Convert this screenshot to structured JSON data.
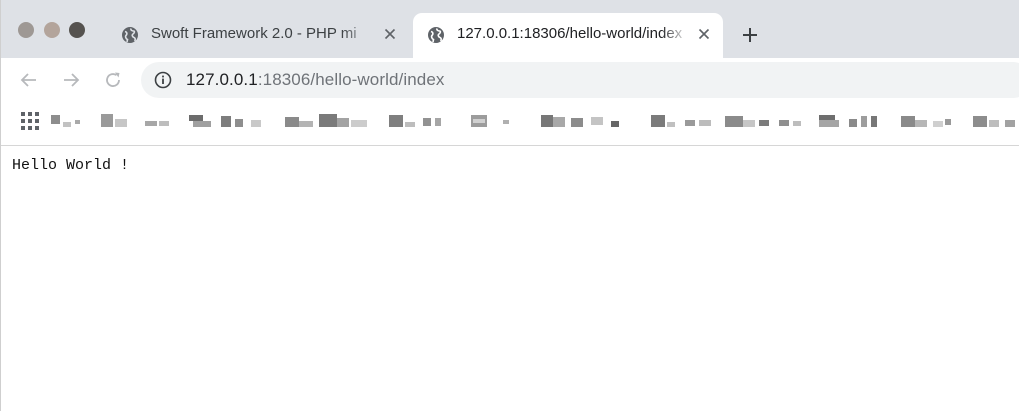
{
  "browser": {
    "tabs": [
      {
        "title": "Swoft Framework 2.0 - PHP mi",
        "favicon": "globe-icon",
        "active": false
      },
      {
        "title": "127.0.0.1:18306/hello-world/index",
        "favicon": "globe-icon",
        "active": true
      }
    ],
    "new_tab_icon": "plus-icon",
    "nav": {
      "back_icon": "arrow-left-icon",
      "forward_icon": "arrow-right-icon",
      "reload_icon": "reload-icon"
    },
    "address_bar": {
      "info_icon": "info-icon",
      "host": "127.0.0.1",
      "rest": ":18306/hello-world/index"
    },
    "bookmarks_bar": {
      "apps_icon": "apps-grid-icon",
      "items_blurred": true
    },
    "colors": {
      "tabstrip": "#dee1e6",
      "omnibox": "#f1f3f4",
      "url_host": "#202124",
      "url_rest": "#6f7378"
    }
  },
  "page": {
    "body_text": "Hello World !"
  }
}
